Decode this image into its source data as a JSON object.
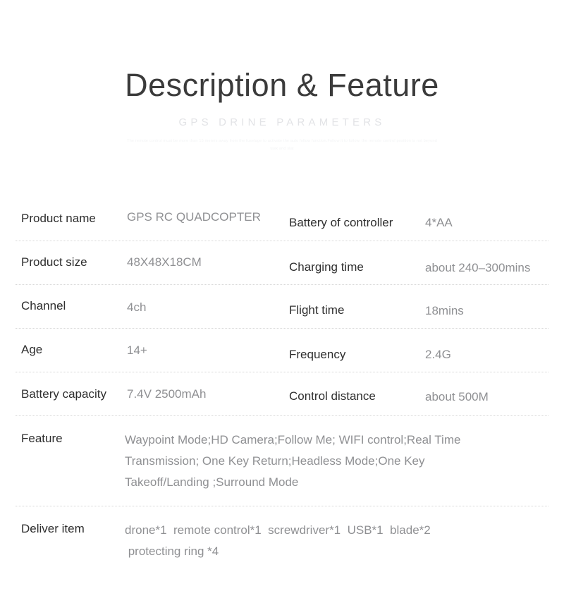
{
  "header": {
    "title": "Description & Feature",
    "subtitle": "GPS DRINE PARAMETERS",
    "fineprint": "The remote control must be more than 15 meters away from the fuselage to activate the auto follow function.Follow it to follow, the remote control position is not beyond task and slat"
  },
  "colors": {
    "title": "#3b3b3b",
    "label": "#2e2e2e",
    "value": "#8f9093",
    "subtitle": "#e2e3e6",
    "divider": "#d8d8d8",
    "background": "#ffffff"
  },
  "spec_rows": [
    {
      "left_label": "Product name",
      "left_value": "GPS RC QUADCOPTER",
      "right_label": "Battery of controller",
      "right_value": "4*AA"
    },
    {
      "left_label": "Product size",
      "left_value": "48X48X18CM",
      "right_label": "Charging time",
      "right_value": "about 240–300mins"
    },
    {
      "left_label": "Channel",
      "left_value": "4ch",
      "right_label": "Flight time",
      "right_value": "18mins"
    },
    {
      "left_label": "Age",
      "left_value": "14+",
      "right_label": "Frequency",
      "right_value": "2.4G"
    },
    {
      "left_label": "Battery capacity",
      "left_value": "7.4V 2500mAh",
      "right_label": "Control distance",
      "right_value": "about 500M"
    }
  ],
  "feature": {
    "label": "Feature",
    "lines": [
      "Waypoint Mode;HD Camera;Follow Me; WIFI control;Real Time",
      "Transmission; One Key Return;Headless Mode;One Key",
      "Takeoff/Landing ;Surround Mode"
    ]
  },
  "deliver": {
    "label": "Deliver item",
    "lines": [
      "drone*1  remote control*1  screwdriver*1  USB*1  blade*2",
      " protecting ring *4"
    ]
  }
}
